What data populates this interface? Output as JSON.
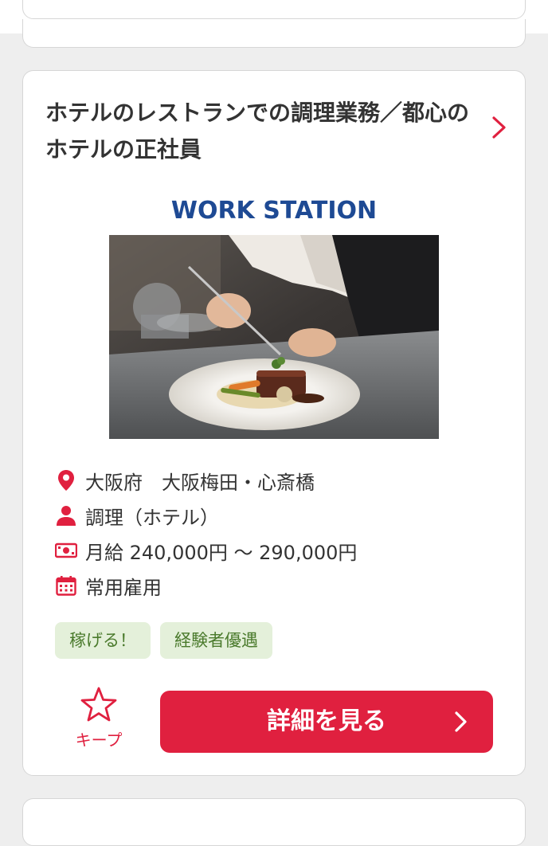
{
  "job": {
    "title": "ホテルのレストランでの調理業務／都心のホテルの正社員",
    "logo_text": "WORK STATION",
    "location": "大阪府　大阪梅田・心斎橋",
    "category": "調理（ホテル）",
    "salary": "月給 240,000円 〜 290,000円",
    "employment": "常用雇用",
    "tags": [
      "稼げる！",
      "経験者優遇"
    ]
  },
  "actions": {
    "keep_label": "キープ",
    "detail_label": "詳細を見る"
  },
  "icons": {
    "location": "map-pin-icon",
    "category": "person-icon",
    "salary": "banknote-icon",
    "employment": "calendar-icon",
    "keep": "star-outline-icon",
    "chevron": "chevron-right-icon"
  },
  "colors": {
    "accent": "#e0203f",
    "tag_bg": "#e4f0da",
    "tag_text": "#4a7a2c",
    "logo": "#1e4a94"
  }
}
